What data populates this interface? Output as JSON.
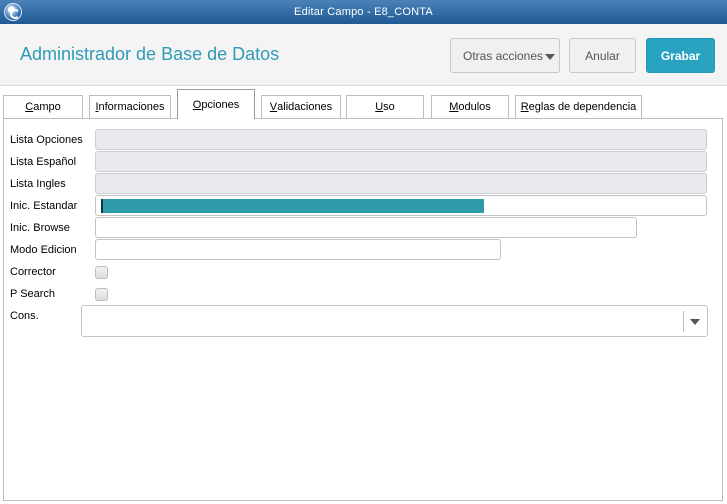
{
  "window": {
    "title": "Editar Campo - E8_CONTA"
  },
  "header": {
    "app_title": "Administrador de Base de Datos",
    "buttons": {
      "more": "Otras acciones",
      "cancel": "Anular",
      "save": "Grabar"
    }
  },
  "tabs": [
    {
      "label": "Campo",
      "accesskey": "C",
      "rest": "ampo"
    },
    {
      "label": "Informaciones",
      "accesskey": "I",
      "rest": "nformaciones"
    },
    {
      "label": "Opciones",
      "accesskey": "O",
      "rest": "pciones",
      "active": true
    },
    {
      "label": "Validaciones",
      "accesskey": "V",
      "rest": "alidaciones"
    },
    {
      "label": "Uso",
      "accesskey": "U",
      "rest": "so"
    },
    {
      "label": "Modulos",
      "accesskey": "M",
      "rest": "odulos"
    },
    {
      "label": "Reglas de dependencia",
      "accesskey": "R",
      "rest": "eglas de dependencia"
    }
  ],
  "form": {
    "lista_opciones": {
      "label": "Lista Opciones",
      "value": ""
    },
    "lista_espanol": {
      "label": "Lista Español",
      "value": ""
    },
    "lista_ingles": {
      "label": "Lista Ingles",
      "value": ""
    },
    "inic_estandar": {
      "label": "Inic. Estandar",
      "value": ""
    },
    "inic_browse": {
      "label": "Inic. Browse",
      "value": ""
    },
    "modo_edicion": {
      "label": "Modo Edicion",
      "value": ""
    },
    "corrector": {
      "label": "Corrector",
      "checked": false
    },
    "p_search": {
      "label": "P Search",
      "checked": false
    },
    "cons": {
      "label": "Cons.",
      "value": ""
    }
  },
  "colors": {
    "accent": "#2aa3c3",
    "title": "#2f9bb6",
    "titlebar": "#2b67a3"
  },
  "icons": {
    "app": "app-logo-icon",
    "dropdown": "chevron-down-icon"
  }
}
